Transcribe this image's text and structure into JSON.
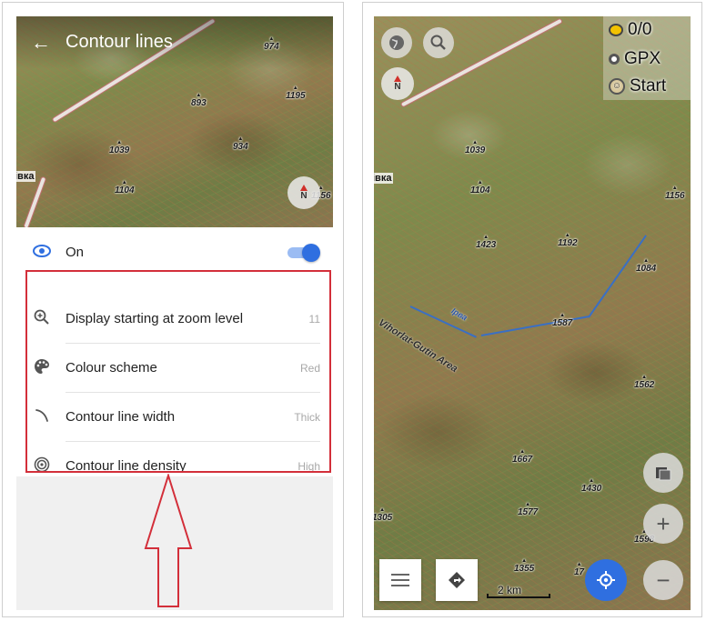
{
  "left": {
    "title": "Contour lines",
    "map_labels": {
      "town": "івка",
      "peaks": [
        "974",
        "1195",
        "893",
        "934",
        "1039",
        "1104",
        "1156"
      ]
    },
    "compass_letter": "N",
    "on_row": {
      "label": "On",
      "toggle_on": true
    },
    "settings": [
      {
        "label": "Display starting at zoom level",
        "value": "11",
        "icon": "zoom-in-icon"
      },
      {
        "label": "Colour scheme",
        "value": "Red",
        "icon": "palette-icon"
      },
      {
        "label": "Contour line width",
        "value": "Thick",
        "icon": "line-width-icon"
      },
      {
        "label": "Contour line density",
        "value": "High",
        "icon": "density-icon"
      }
    ],
    "accent": "#2f6fe0",
    "annotation_color": "#d32f3a"
  },
  "right": {
    "info": {
      "gps": "0/0",
      "gpx": "GPX",
      "start": "Start"
    },
    "compass_letter": "N",
    "map_labels": {
      "town": "івка",
      "peaks": [
        "1039",
        "1104",
        "1156",
        "1423",
        "1192",
        "1084",
        "1587",
        "1562",
        "1667",
        "1430",
        "1305",
        "1577",
        "1598",
        "1355",
        "17"
      ],
      "area": "Vihorlat-Gutin Area",
      "river": "Ірва"
    },
    "scale": "2 km",
    "zoom_in": "+",
    "zoom_out": "−"
  }
}
